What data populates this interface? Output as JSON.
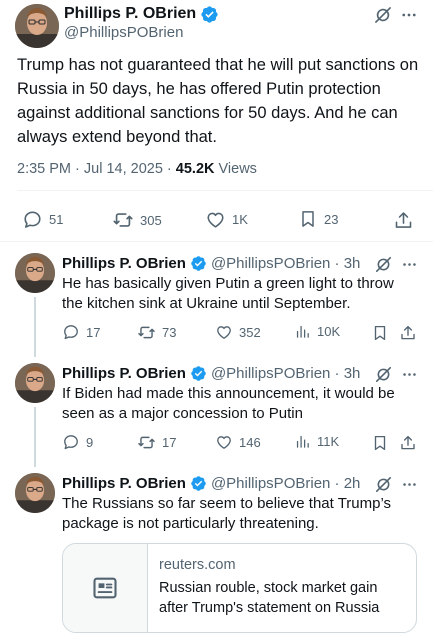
{
  "main_tweet": {
    "author_name": "Phillips P. OBrien",
    "handle": "@PhillipsPOBrien",
    "text": "Trump has not guaranteed that he will put sanctions on Russia in 50 days, he has offered Putin protection against additional sanctions for 50 days. And he can always extend beyond that.",
    "time": "2:35 PM · Jul 14, 2025 · ",
    "views_count": "45.2K",
    "views_label": " Views",
    "replies": "51",
    "reposts": "305",
    "likes": "1K",
    "bookmarks": "23"
  },
  "replies": [
    {
      "author_name": "Phillips P. OBrien",
      "handle_time": "@PhillipsPOBrien · 3h",
      "text": "He has basically given Putin a green light to throw the kitchen sink at Ukraine until September.",
      "replies": "17",
      "reposts": "73",
      "likes": "352",
      "views": "10K"
    },
    {
      "author_name": "Phillips P. OBrien",
      "handle_time": "@PhillipsPOBrien · 3h",
      "text": "If Biden had made this announcement, it would be seen as a major concession to Putin",
      "replies": "9",
      "reposts": "17",
      "likes": "146",
      "views": "11K"
    },
    {
      "author_name": "Phillips P. OBrien",
      "handle_time": "@PhillipsPOBrien · 2h",
      "text": "The Russians so far seem to believe that Trump’s package is not particularly threatening.",
      "link_card": {
        "domain": "reuters.com",
        "title": "Russian rouble, stock market gain after Trump's statement on Russia"
      }
    }
  ],
  "colors": {
    "verified_blue": "#1d9bf0",
    "text_primary": "#0f1419",
    "text_secondary": "#536471"
  },
  "icons": [
    "grok-icon",
    "more-icon",
    "reply-icon",
    "repost-icon",
    "like-icon",
    "bookmark-icon",
    "share-icon",
    "views-icon",
    "article-icon",
    "verified-badge-icon"
  ]
}
